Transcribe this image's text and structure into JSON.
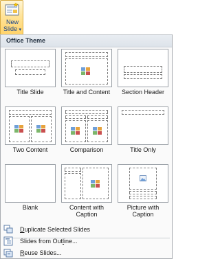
{
  "new_slide": {
    "label_line1": "New",
    "label_line2": "Slide",
    "caret": "▾"
  },
  "gallery": {
    "header": "Office Theme",
    "layouts": [
      {
        "label": "Title Slide"
      },
      {
        "label": "Title and Content"
      },
      {
        "label": "Section Header"
      },
      {
        "label": "Two Content"
      },
      {
        "label": "Comparison"
      },
      {
        "label": "Title Only"
      },
      {
        "label": "Blank"
      },
      {
        "label_line1": "Content with",
        "label_line2": "Caption"
      },
      {
        "label_line1": "Picture with",
        "label_line2": "Caption"
      }
    ]
  },
  "menu": {
    "items": [
      {
        "mnemonic": "D",
        "rest": "uplicate Selected Slides",
        "icon": "duplicate-slides-icon"
      },
      {
        "prefix": "Slides from Out",
        "mnemonic": "l",
        "rest": "ine...",
        "icon": "outline-icon"
      },
      {
        "mnemonic": "R",
        "rest": "euse Slides...",
        "icon": "reuse-slides-icon"
      }
    ]
  }
}
